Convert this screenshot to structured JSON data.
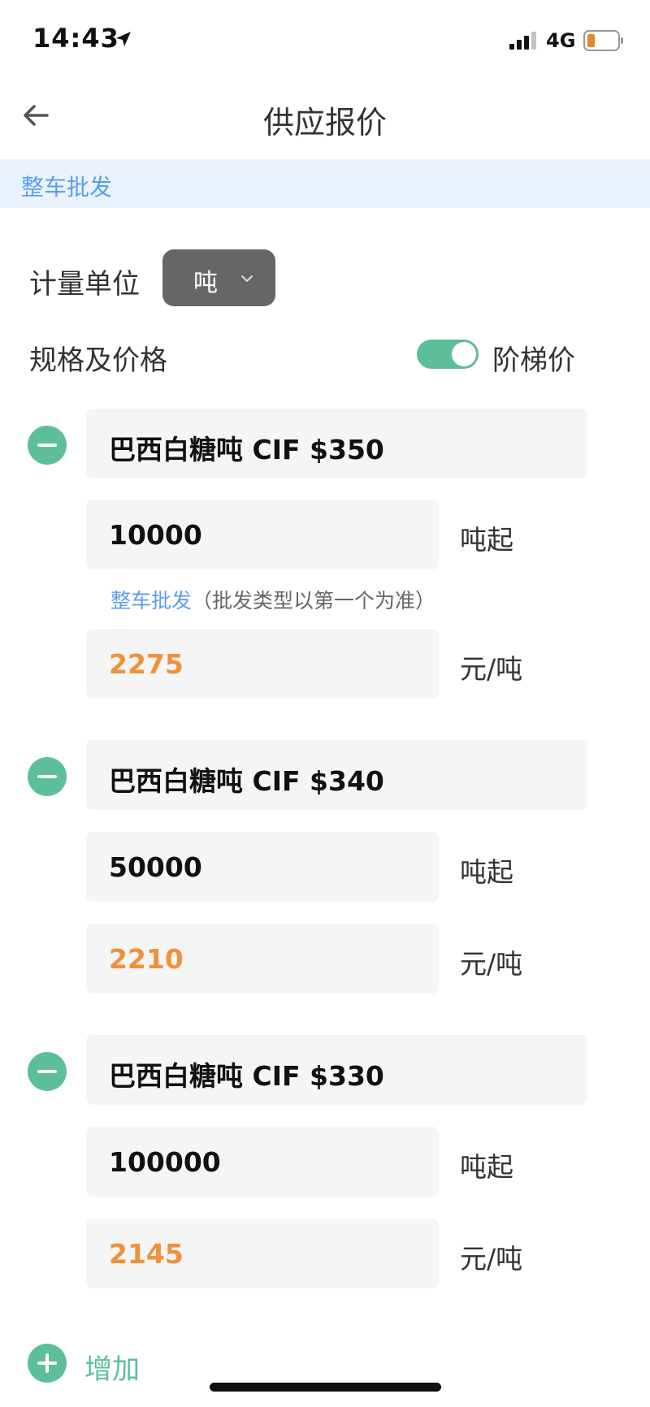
{
  "status": {
    "time": "14:43",
    "network": "4G",
    "icons": [
      "location-arrow-icon",
      "signal-icon",
      "battery-icon"
    ]
  },
  "nav": {
    "title": "供应报价",
    "back_icon": "back-arrow-icon"
  },
  "banner": {
    "text": "整车批发"
  },
  "unit": {
    "label": "计量单位",
    "selected": "吨",
    "icon": "chevron-down-icon"
  },
  "spec": {
    "label": "规格及价格",
    "tier_label": "阶梯价",
    "tier_enabled": true
  },
  "tiers": [
    {
      "name": "巴西白糖吨 CIF $350",
      "quantity": "10000",
      "quantity_suffix": "吨起",
      "hint_link": "整车批发",
      "hint_text": "（批发类型以第一个为准）",
      "price": "2275",
      "price_suffix": "元/吨"
    },
    {
      "name": "巴西白糖吨 CIF $340",
      "quantity": "50000",
      "quantity_suffix": "吨起",
      "price": "2210",
      "price_suffix": "元/吨"
    },
    {
      "name": "巴西白糖吨 CIF $330",
      "quantity": "100000",
      "quantity_suffix": "吨起",
      "price": "2145",
      "price_suffix": "元/吨"
    }
  ],
  "add": {
    "label": "增加"
  },
  "colors": {
    "accent_green": "#5dbe9a",
    "link_blue": "#5b9ef0",
    "price_orange": "#f0913a",
    "banner_bg": "#eaf3fd"
  }
}
